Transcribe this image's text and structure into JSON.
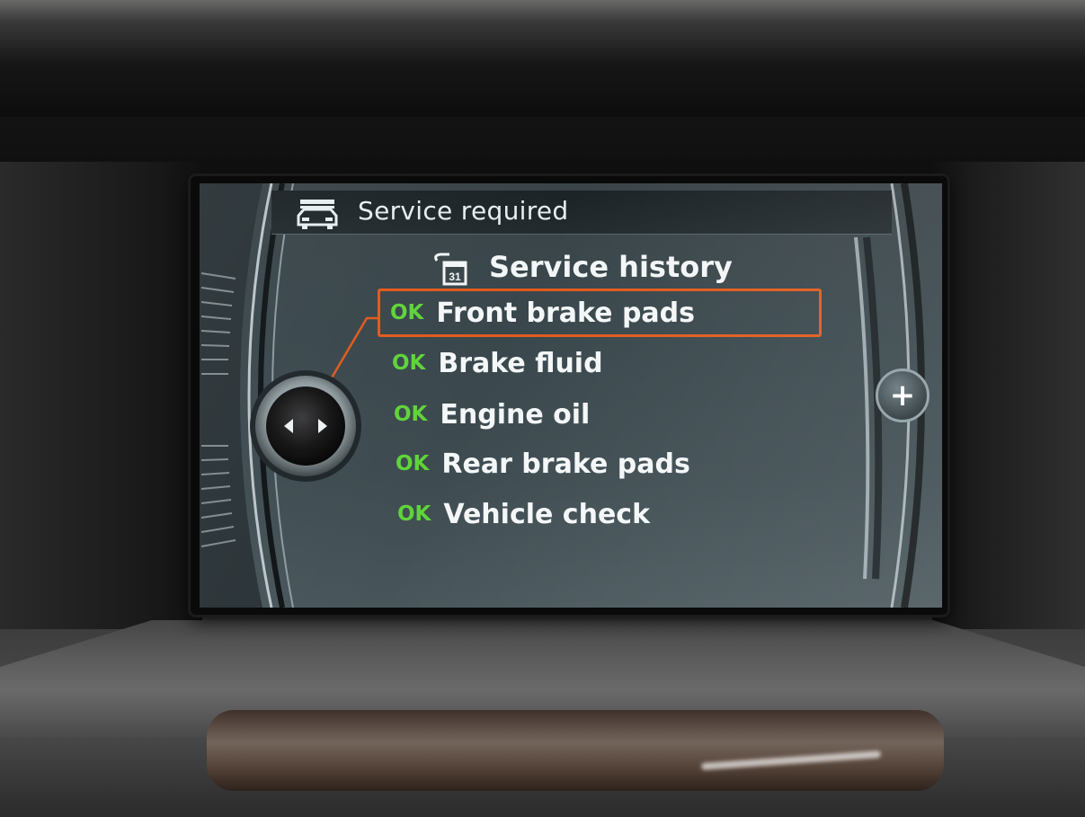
{
  "header": {
    "title": "Service required",
    "title_icon": "car-service-icon"
  },
  "history": {
    "label": "Service history",
    "icon": "calendar-service-icon",
    "calendar_day": "31"
  },
  "items": [
    {
      "status": "OK",
      "label": "Front brake pads",
      "selected": true
    },
    {
      "status": "OK",
      "label": "Brake fluid",
      "selected": false
    },
    {
      "status": "OK",
      "label": "Engine oil",
      "selected": false
    },
    {
      "status": "OK",
      "label": "Rear brake pads",
      "selected": false
    },
    {
      "status": "OK",
      "label": "Vehicle check",
      "selected": false
    }
  ],
  "controls": {
    "plus_label": "+",
    "controller_icon": "idrive-controller-icon"
  },
  "colors": {
    "ok": "#5fd43a",
    "highlight": "#e25a1c",
    "text": "#f4f7f8"
  }
}
